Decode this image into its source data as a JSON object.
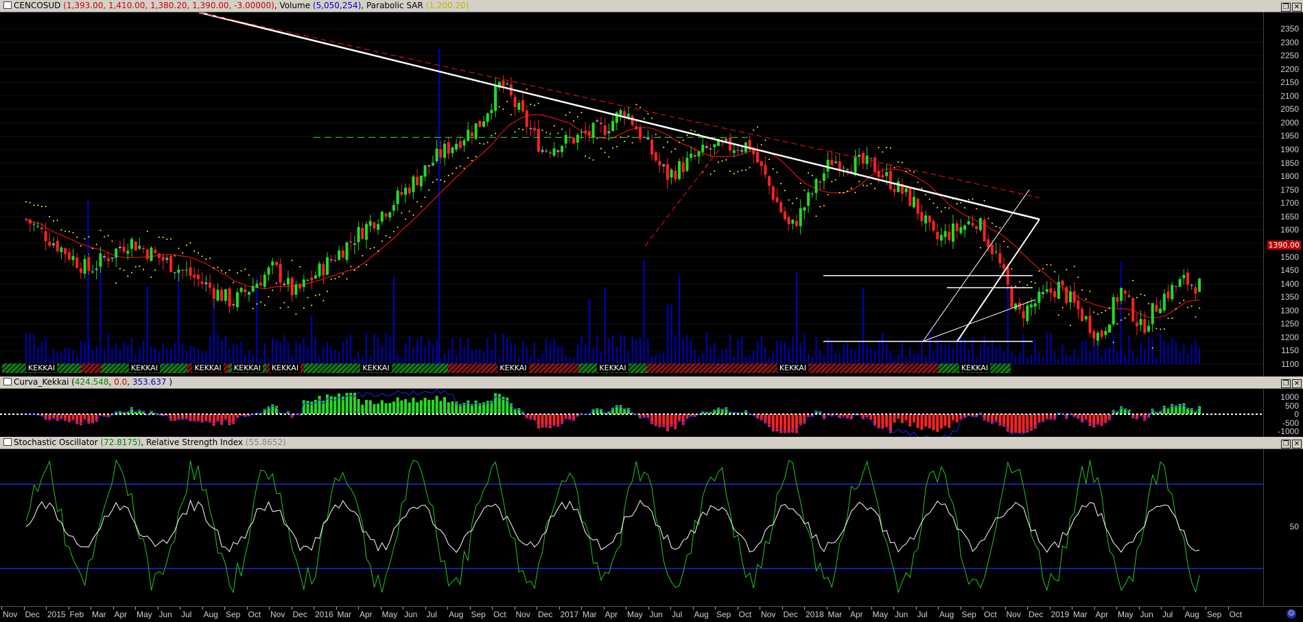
{
  "colors": {
    "bull": "#22dd22",
    "bull_fill": "#00c000",
    "bear": "#ff2222",
    "neutral": "#8a8ad8",
    "ma": "#e01010",
    "sar": "#ffff44",
    "volume": "#0000c8",
    "trend": "#ffffff",
    "trend_dash": "#d01010",
    "stoch": "#22c822",
    "rsi": "#ffffff",
    "hist_pos": "#22dd22",
    "hist_neg": "#ff2222",
    "curve_line": "#2020ff",
    "band": "#1e2ad8"
  },
  "panes": {
    "main": {
      "title_parts": [
        {
          "text": "CENCOSUD",
          "color": "#000000"
        },
        {
          "text": " (1,393.00, 1,410.00, 1,380.20, 1,390.00, -3.00000)",
          "color": "#cc0000"
        },
        {
          "text": ", Volume ",
          "color": "#000000"
        },
        {
          "text": "(5,050,254)",
          "color": "#0000cc"
        },
        {
          "text": ", Parabolic SAR ",
          "color": "#000000"
        },
        {
          "text": "(1,200.20)",
          "color": "#b8b800"
        }
      ],
      "price_tag": "1390.00",
      "y_ticks": [
        "2350",
        "2300",
        "2250",
        "2200",
        "2150",
        "2100",
        "2050",
        "2000",
        "1950",
        "1900",
        "1850",
        "1800",
        "1750",
        "1700",
        "1650",
        "1600",
        "1550",
        "1500",
        "1450",
        "1400",
        "1350",
        "1300",
        "1250",
        "1200",
        "1150",
        "1100"
      ],
      "kekkai": [
        {
          "label": "KEKKAI",
          "type": "g"
        },
        {
          "label": "",
          "type": "r"
        },
        {
          "label": "KEKKAI",
          "type": "g"
        },
        {
          "label": "KEKKAI",
          "type": "r"
        },
        {
          "label": "KEKKAI",
          "type": "g"
        },
        {
          "label": "KEKKAI",
          "type": "r"
        },
        {
          "label": "KEKKAI",
          "type": "g"
        },
        {
          "label": "KEKKAI",
          "type": "r"
        },
        {
          "label": "KEKKAI",
          "type": "g"
        },
        {
          "label": "KEKKAI",
          "type": "r"
        },
        {
          "label": "KEKKAI",
          "type": "g"
        }
      ]
    },
    "curva": {
      "title_parts": [
        {
          "text": "Curva_Kekkai ",
          "color": "#000000"
        },
        {
          "text": "(",
          "color": "#000000"
        },
        {
          "text": "424.548",
          "color": "#008800"
        },
        {
          "text": ", ",
          "color": "#000000"
        },
        {
          "text": "0.0",
          "color": "#cc0000"
        },
        {
          "text": ", ",
          "color": "#000000"
        },
        {
          "text": "353.637",
          "color": "#0000cc"
        },
        {
          "text": " )",
          "color": "#000000"
        }
      ],
      "y_ticks": [
        "1000",
        "500",
        "0",
        "-500",
        "-1000"
      ]
    },
    "osc": {
      "title_parts": [
        {
          "text": "Stochastic Oscillator ",
          "color": "#000000"
        },
        {
          "text": "(72.8175)",
          "color": "#008800"
        },
        {
          "text": ", Relative Strength Index ",
          "color": "#000000"
        },
        {
          "text": "(55.8652)",
          "color": "#888888"
        }
      ],
      "y_ticks": [
        "50"
      ]
    }
  },
  "x_labels": [
    "Nov",
    "Dec",
    "2015",
    "Feb",
    "Mar",
    "Apr",
    "May",
    "Jun",
    "Jul",
    "Aug",
    "Sep",
    "Oct",
    "Nov",
    "Dec",
    "2016",
    "Mar",
    "Apr",
    "May",
    "Jun",
    "Jul",
    "Aug",
    "Sep",
    "Oct",
    "Nov",
    "Dec",
    "2017",
    "Mar",
    "Apr",
    "May",
    "Jun",
    "Jul",
    "Aug",
    "Sep",
    "Oct",
    "Nov",
    "Dec",
    "2018",
    "Mar",
    "Apr",
    "May",
    "Jun",
    "Jul",
    "Aug",
    "Sep",
    "Oct",
    "Nov",
    "Dec",
    "2019",
    "Mar",
    "Apr",
    "May",
    "Jun",
    "Jul",
    "Aug",
    "Sep",
    "Oct"
  ],
  "chart_data": [
    {
      "type": "candlestick",
      "title": "CENCOSUD",
      "symbol": "CENCOSUD",
      "timeframe": "weekly",
      "last": {
        "open": 1393.0,
        "high": 1410.0,
        "low": 1380.2,
        "close": 1390.0,
        "change": -3.0
      },
      "ylim": [
        1070,
        2380
      ],
      "x_range": [
        "2014-10",
        "2019-10"
      ],
      "indicators": {
        "volume_last": 5050254,
        "parabolic_sar_last": 1200.2,
        "moving_average": "red line"
      },
      "approx_close_path": [
        {
          "x": "2014-11",
          "y": 1640
        },
        {
          "x": "2015-02",
          "y": 1450
        },
        {
          "x": "2015-04",
          "y": 1560
        },
        {
          "x": "2015-07",
          "y": 1430
        },
        {
          "x": "2015-09",
          "y": 1330
        },
        {
          "x": "2015-11",
          "y": 1460
        },
        {
          "x": "2015-12",
          "y": 1360
        },
        {
          "x": "2016-03",
          "y": 1580
        },
        {
          "x": "2016-05",
          "y": 1720
        },
        {
          "x": "2016-07",
          "y": 1880
        },
        {
          "x": "2016-09",
          "y": 2000
        },
        {
          "x": "2016-10",
          "y": 2150
        },
        {
          "x": "2016-12",
          "y": 1900
        },
        {
          "x": "2017-03",
          "y": 1980
        },
        {
          "x": "2017-04",
          "y": 2050
        },
        {
          "x": "2017-06",
          "y": 1800
        },
        {
          "x": "2017-08",
          "y": 1900
        },
        {
          "x": "2017-10",
          "y": 1920
        },
        {
          "x": "2017-12",
          "y": 1600
        },
        {
          "x": "2018-02",
          "y": 1860
        },
        {
          "x": "2018-04",
          "y": 1840
        },
        {
          "x": "2018-06",
          "y": 1700
        },
        {
          "x": "2018-07",
          "y": 1560
        },
        {
          "x": "2018-09",
          "y": 1640
        },
        {
          "x": "2018-10",
          "y": 1500
        },
        {
          "x": "2018-11",
          "y": 1280
        },
        {
          "x": "2019-01",
          "y": 1390
        },
        {
          "x": "2019-03",
          "y": 1200
        },
        {
          "x": "2019-04",
          "y": 1380
        },
        {
          "x": "2019-05",
          "y": 1230
        },
        {
          "x": "2019-06",
          "y": 1350
        },
        {
          "x": "2019-07",
          "y": 1410
        },
        {
          "x": "2019-08",
          "y": 1390
        }
      ],
      "horizontal_levels": [
        1945,
        1430,
        1385,
        1185
      ],
      "annotations": [
        "downtrend line (white)",
        "downtrend line (red dashed)",
        "ascending channel (white)",
        "KEKKAI bands"
      ]
    },
    {
      "type": "bar",
      "title": "Curva_Kekkai",
      "values_last": [
        424.548,
        0.0,
        353.637
      ],
      "ylim": [
        -1200,
        1300
      ]
    },
    {
      "type": "line",
      "title": "Stochastic Oscillator / Relative Strength Index",
      "series": [
        {
          "name": "Stochastic Oscillator",
          "last": 72.8175
        },
        {
          "name": "Relative Strength Index",
          "last": 55.8652
        }
      ],
      "ylim": [
        0,
        100
      ]
    }
  ]
}
